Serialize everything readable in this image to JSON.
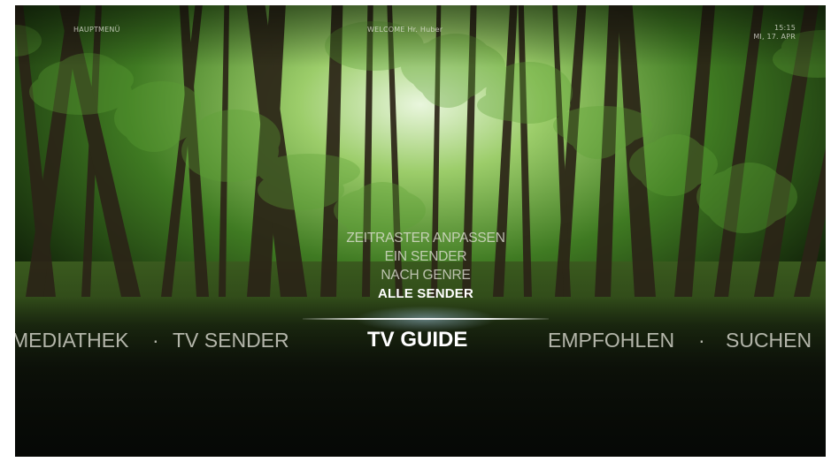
{
  "header": {
    "left_label": "HAUPTMENÜ",
    "center_label": "WELCOME Hr. Huber",
    "time": "15:15",
    "date": "MI, 17. APR"
  },
  "submenu": {
    "items": [
      {
        "label": "ZEITRASTER ANPASSEN",
        "active": false
      },
      {
        "label": "EIN SENDER",
        "active": false
      },
      {
        "label": "NACH GENRE",
        "active": false
      },
      {
        "label": "ALLE SENDER",
        "active": true
      }
    ]
  },
  "main_menu": {
    "items": [
      {
        "label": "MEDIATHEK"
      },
      {
        "label": "TV SENDER"
      },
      {
        "label": "TV GUIDE",
        "selected": true
      },
      {
        "label": "EMPFOHLEN"
      },
      {
        "label": "SUCHEN"
      }
    ],
    "separator": "·"
  },
  "background": {
    "scene": "forest",
    "colors": {
      "canopy": "#4a8a2a",
      "light": "#d8f0c0",
      "trunk": "#2a2418",
      "floor": "#0d1208"
    }
  }
}
